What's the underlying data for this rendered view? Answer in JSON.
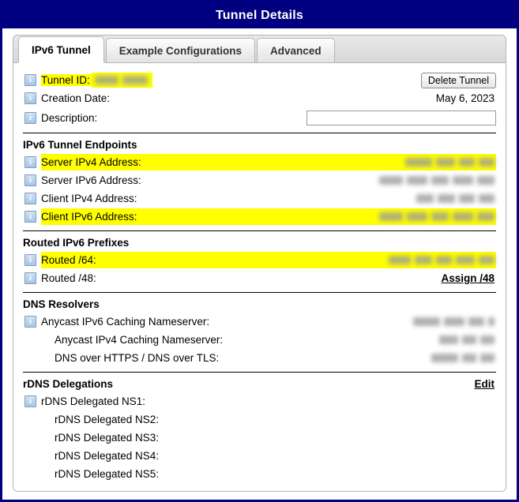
{
  "window": {
    "title": "Tunnel Details"
  },
  "tabs": [
    {
      "label": "IPv6 Tunnel",
      "active": true
    },
    {
      "label": "Example Configurations",
      "active": false
    },
    {
      "label": "Advanced",
      "active": false
    }
  ],
  "colors": {
    "titlebar_bg": "#000080",
    "titlebar_text": "#ffffff",
    "highlight": "#ffff00",
    "panel_border": "#b5b5b5",
    "redacted": "#9a9a9a"
  },
  "info_rows": {
    "tunnel_id": {
      "label": "Tunnel ID:",
      "value": "",
      "redacted": true,
      "highlighted": true
    },
    "creation_date": {
      "label": "Creation Date:",
      "value": "May 6, 2023",
      "redacted": false,
      "highlighted": false
    },
    "description": {
      "label": "Description:",
      "value": "",
      "placeholder": ""
    },
    "delete_button": {
      "label": "Delete Tunnel"
    }
  },
  "sections": [
    {
      "title": "IPv6 Tunnel Endpoints",
      "action": null,
      "rows": [
        {
          "label": "Server IPv4 Address:",
          "value": "",
          "redacted": true,
          "highlighted": true,
          "icon": true
        },
        {
          "label": "Server IPv6 Address:",
          "value": "",
          "redacted": true,
          "highlighted": false,
          "icon": true
        },
        {
          "label": "Client IPv4 Address:",
          "value": "",
          "redacted": true,
          "highlighted": false,
          "icon": true
        },
        {
          "label": "Client IPv6 Address:",
          "value": "",
          "redacted": true,
          "highlighted": true,
          "icon": true
        }
      ]
    },
    {
      "title": "Routed IPv6 Prefixes",
      "action": null,
      "rows": [
        {
          "label": "Routed /64:",
          "value": "",
          "redacted": true,
          "highlighted": true,
          "icon": true
        },
        {
          "label": "Routed /48:",
          "value": "Assign /48",
          "link": true,
          "redacted": false,
          "highlighted": false,
          "icon": true
        }
      ]
    },
    {
      "title": "DNS Resolvers",
      "action": null,
      "rows": [
        {
          "label": "Anycast IPv6 Caching Nameserver:",
          "value": "",
          "redacted": true,
          "highlighted": false,
          "icon": true
        },
        {
          "label": "Anycast IPv4 Caching Nameserver:",
          "value": "",
          "redacted": true,
          "highlighted": false,
          "icon": false
        },
        {
          "label": "DNS over HTTPS / DNS over TLS:",
          "value": "",
          "redacted": true,
          "highlighted": false,
          "icon": false
        }
      ]
    },
    {
      "title": "rDNS Delegations",
      "action": "Edit",
      "rows": [
        {
          "label": "rDNS Delegated NS1:",
          "value": "",
          "redacted": false,
          "highlighted": false,
          "icon": true
        },
        {
          "label": "rDNS Delegated NS2:",
          "value": "",
          "redacted": false,
          "highlighted": false,
          "icon": false
        },
        {
          "label": "rDNS Delegated NS3:",
          "value": "",
          "redacted": false,
          "highlighted": false,
          "icon": false
        },
        {
          "label": "rDNS Delegated NS4:",
          "value": "",
          "redacted": false,
          "highlighted": false,
          "icon": false
        },
        {
          "label": "rDNS Delegated NS5:",
          "value": "",
          "redacted": false,
          "highlighted": false,
          "icon": false
        }
      ]
    }
  ],
  "redaction_widths": {
    "tunnel_id": [
      30,
      32
    ],
    "server_ipv4": [
      34,
      24,
      20,
      20
    ],
    "server_ipv6": [
      30,
      26,
      22,
      26,
      22
    ],
    "client_ipv4": [
      22,
      22,
      20,
      20
    ],
    "client_ipv6": [
      30,
      26,
      22,
      26,
      22
    ],
    "routed_64": [
      28,
      22,
      20,
      24,
      20
    ],
    "dns_v6": [
      34,
      26,
      20,
      8
    ],
    "dns_v4": [
      24,
      18,
      18
    ],
    "doh": [
      34,
      18,
      18
    ]
  }
}
